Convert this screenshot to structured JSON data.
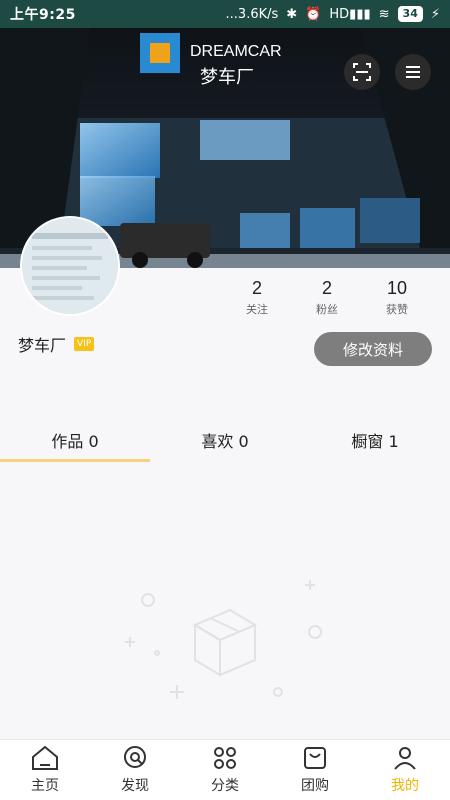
{
  "statusbar": {
    "time": "上午9:25",
    "network": "...3.6K/s",
    "signal": "HD",
    "battery": "34"
  },
  "header": {
    "brand_name": "DREAMCAR",
    "brand_cn": "梦车厂"
  },
  "profile": {
    "name": "梦车厂",
    "vip_badge": "VIP",
    "edit_label": "修改资料",
    "stats": [
      {
        "count": "2",
        "label": "关注"
      },
      {
        "count": "2",
        "label": "粉丝"
      },
      {
        "count": "10",
        "label": "获赞"
      }
    ]
  },
  "tabs": [
    {
      "label": "作品 0",
      "active": true
    },
    {
      "label": "喜欢 0",
      "active": false
    },
    {
      "label": "橱窗 1",
      "active": false
    }
  ],
  "nav": [
    {
      "label": "主页",
      "icon": "home-icon",
      "active": false
    },
    {
      "label": "发现",
      "icon": "discover-icon",
      "active": false
    },
    {
      "label": "分类",
      "icon": "category-icon",
      "active": false
    },
    {
      "label": "团购",
      "icon": "groupbuy-icon",
      "active": false
    },
    {
      "label": "我的",
      "icon": "profile-icon",
      "active": true
    }
  ],
  "colors": {
    "status_bar": "#1d4b43",
    "accent": "#f2b300",
    "edit_button": "#7e7e7e"
  }
}
